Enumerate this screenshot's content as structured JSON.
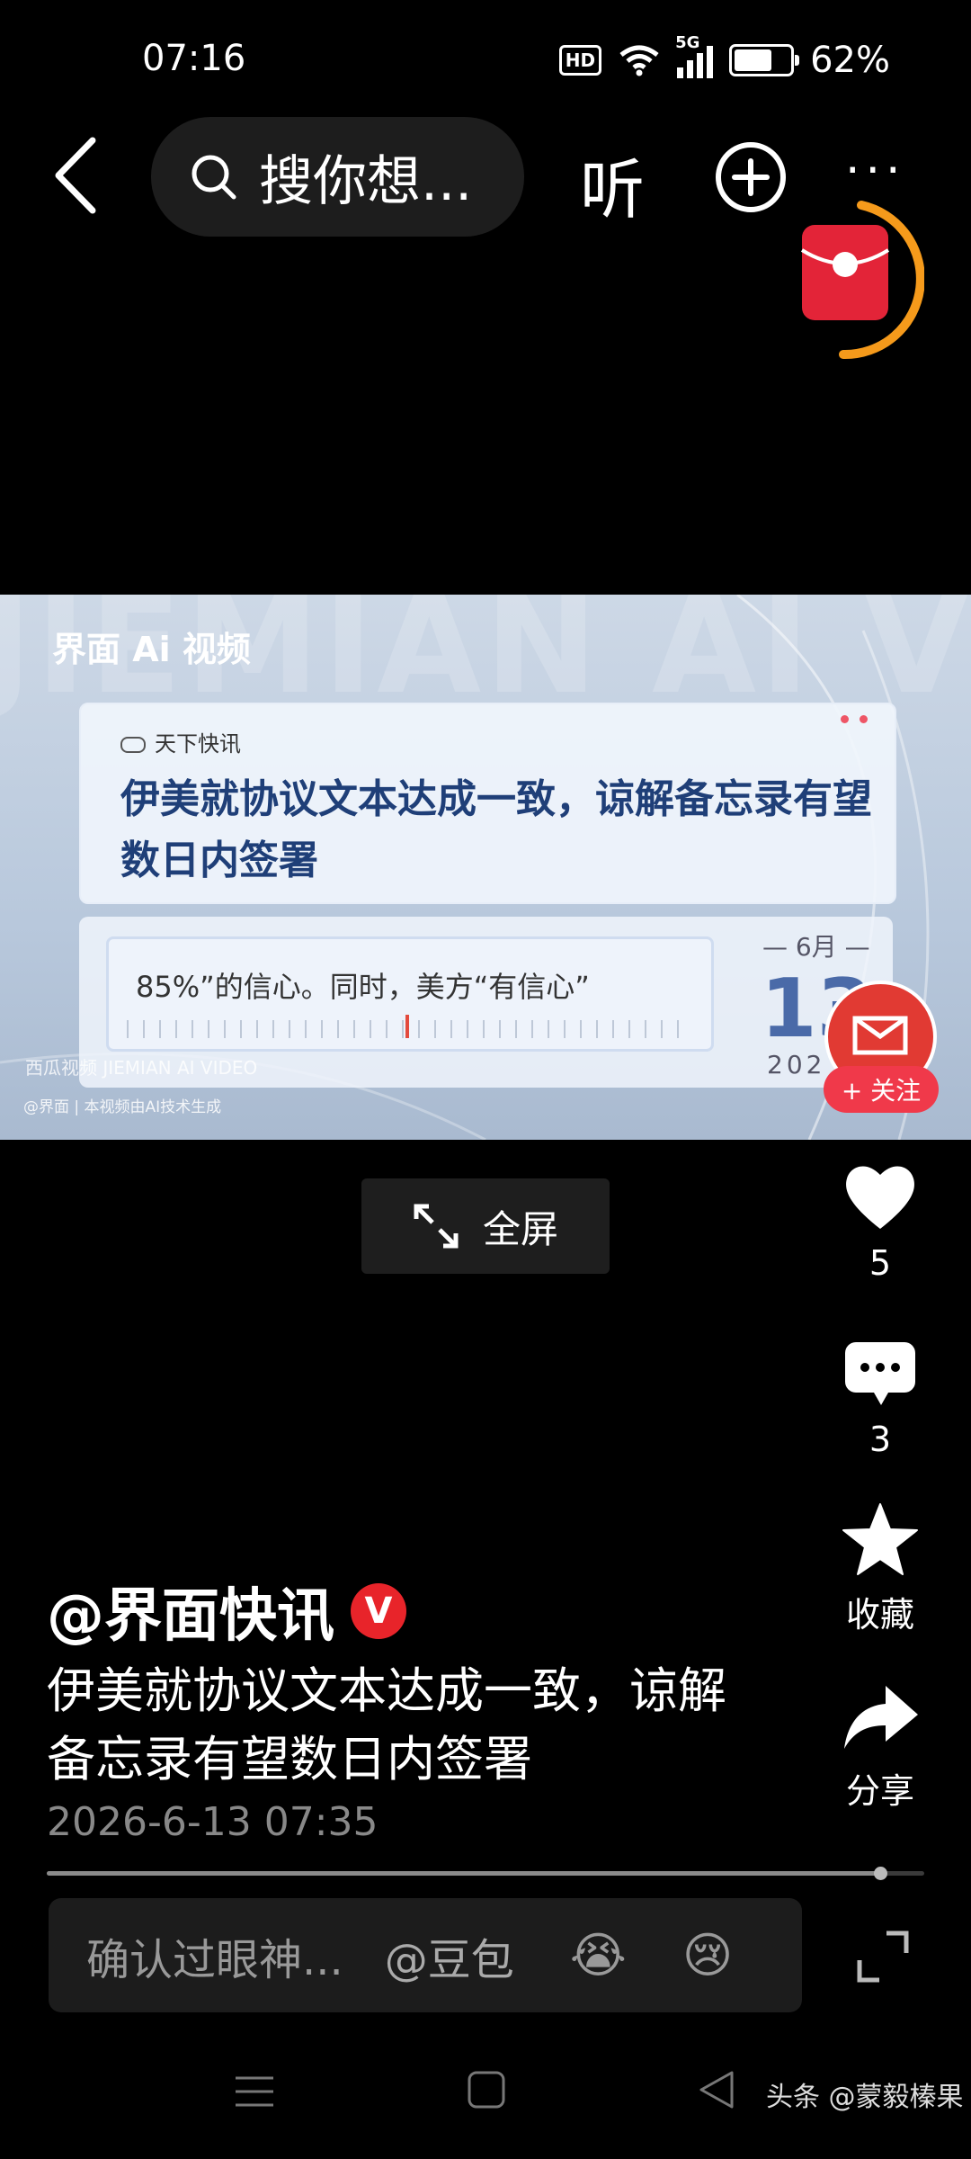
{
  "status": {
    "time": "07:16",
    "network": "5G",
    "hd": "HD",
    "battery_text": "62%",
    "battery_level": 0.62
  },
  "nav": {
    "search_placeholder": "搜你想...",
    "listen_label": "听",
    "more_label": "···"
  },
  "video": {
    "brand": "界面 Ai 视频",
    "watermark": "JIEMIAN AI VIDEO",
    "tag": "天下快讯",
    "headline": "伊美就协议文本达成一致，谅解备忘录有望数日内签署",
    "subtitle": "85%”的信心。同时，美方“有信心”",
    "date_month": "— 6月 —",
    "date_day": "13",
    "date_year": "202",
    "small_logo": "西瓜视频  JIEMIAN AI VIDEO",
    "ai_note": "@界面 | 本视频由AI技术生成"
  },
  "follow_label": "+ 关注",
  "fullscreen_label": "全屏",
  "actions": {
    "like_count": "5",
    "comment_count": "3",
    "favorite_label": "收藏",
    "share_label": "分享"
  },
  "post": {
    "author": "@界面快讯",
    "verified_badge": "V",
    "description": "伊美就协议文本达成一致，谅解备忘录有望数日内签署",
    "timestamp": "2026-6-13 07:35",
    "progress": 0.95
  },
  "comment_bar": {
    "placeholder": "确认过眼神...",
    "mention": "@豆包",
    "emoji1": "😭",
    "emoji2": "😢"
  },
  "credit": "头条 @蒙毅榛果"
}
